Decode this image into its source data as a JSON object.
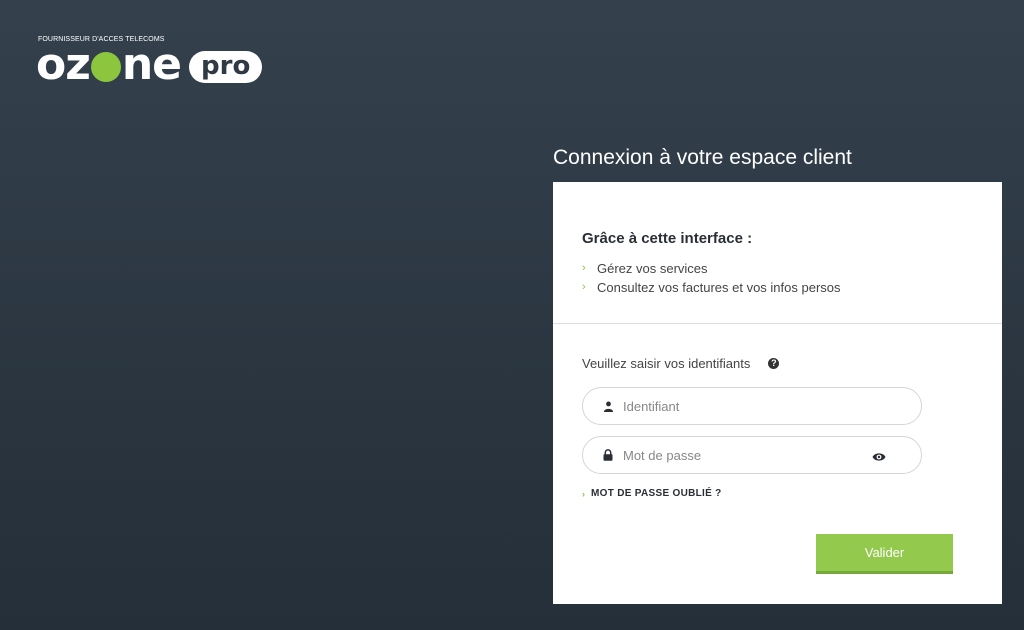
{
  "brand": {
    "tagline": "FOURNISSEUR D'ACCES TELECOMS",
    "word_start": "oz",
    "word_end": "ne",
    "pill": "pro",
    "accent_color": "#8cc63f"
  },
  "login": {
    "title": "Connexion à votre espace client",
    "info": {
      "heading": "Grâce à cette interface :",
      "items": [
        "Gérez vos services",
        "Consultez vos factures et vos infos persos"
      ]
    },
    "form": {
      "prompt": "Veuillez saisir vos identifiants",
      "username": {
        "value": "",
        "placeholder": "Identifiant",
        "icon": "user-icon"
      },
      "password": {
        "value": "",
        "placeholder": "Mot de passe",
        "icon": "lock-icon",
        "toggle_icon": "eye-icon"
      },
      "forgot_label": "MOT DE PASSE OUBLIÉ ?",
      "submit_label": "Valider",
      "help_icon": "question-circle-icon"
    }
  }
}
